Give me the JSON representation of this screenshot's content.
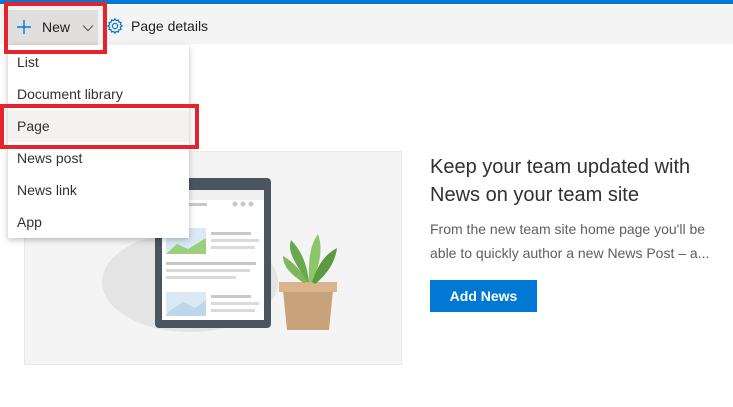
{
  "toolbar": {
    "new_label": "New",
    "page_details_label": "Page details"
  },
  "new_menu": {
    "items": [
      {
        "label": "List"
      },
      {
        "label": "Document library"
      },
      {
        "label": "Page"
      },
      {
        "label": "News post"
      },
      {
        "label": "News link"
      },
      {
        "label": "App"
      }
    ]
  },
  "news_promo": {
    "title_line1": "Keep your team updated with",
    "title_line2": "News on your team site",
    "desc_line1": "From the new team site home page you'll be",
    "desc_line2": "able to quickly author a new News Post – a...",
    "button_label": "Add News"
  },
  "icons": {
    "new": "plus-icon",
    "dropdown": "chevron-down-icon",
    "page_details": "gear-icon"
  },
  "colors": {
    "accent": "#0078d4",
    "highlight_box": "#e3242b",
    "command_bar": "#f4f4f4"
  }
}
